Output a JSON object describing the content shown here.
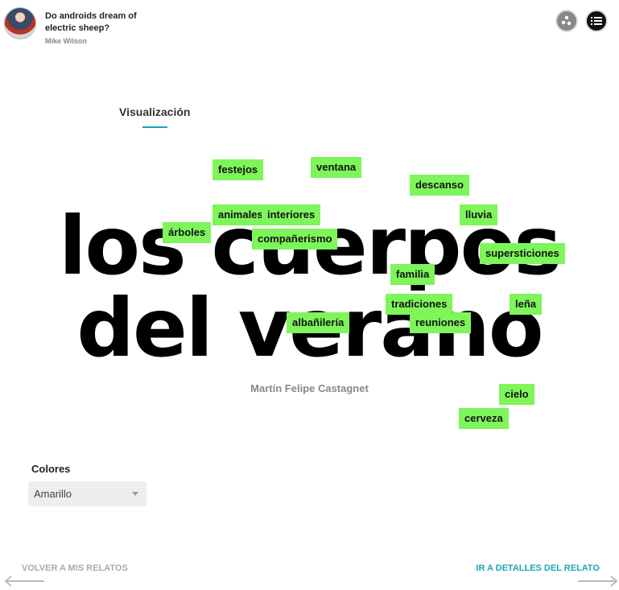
{
  "header": {
    "story_title": "Do androids dream of electric sheep?",
    "author": "Mike Wilson",
    "avatar_icon": "superhero-avatar",
    "viz_icon": "dots-icon",
    "list_icon": "list-icon"
  },
  "section": {
    "title": "Visualización"
  },
  "main": {
    "title_line1": "los cuerpos",
    "title_line2": "del verano",
    "author": "Martín Felipe Castagnet"
  },
  "tags": [
    "festejos",
    "ventana",
    "descanso",
    "animales",
    "interiores",
    "lluvia",
    "árboles",
    "compañerismo",
    "supersticiones",
    "familia",
    "tradiciones",
    "leña",
    "albañilería",
    "reuniones",
    "cielo",
    "cerveza"
  ],
  "colors": {
    "label": "Colores",
    "selected": "Amarillo",
    "tag_color": "#7ef55a",
    "accent": "#1ba6b5"
  },
  "nav": {
    "back": "VOLVER A MIS RELATOS",
    "forward": "IR A DETALLES DEL RELATO"
  }
}
